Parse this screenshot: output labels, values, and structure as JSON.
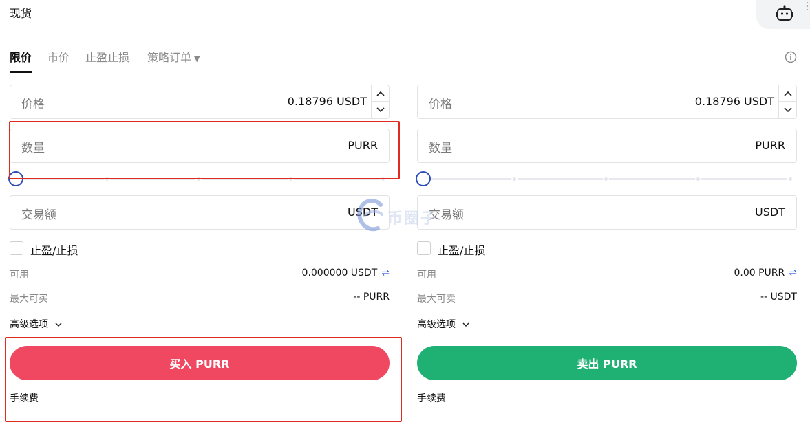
{
  "page": {
    "title": "现货"
  },
  "tabs": [
    {
      "label": "限价",
      "active": true
    },
    {
      "label": "市价",
      "active": false
    },
    {
      "label": "止盈止损",
      "active": false
    },
    {
      "label": "策略订单",
      "active": false,
      "has_dropdown": true
    }
  ],
  "buy": {
    "price_label": "价格",
    "price_value": "0.18796 USDT",
    "qty_label": "数量",
    "qty_unit": "PURR",
    "slider_percent": 0,
    "amount_label": "交易额",
    "amount_unit": "USDT",
    "tpsl_label": "止盈/止损",
    "available_label": "可用",
    "available_value": "0.000000 USDT",
    "max_label": "最大可买",
    "max_value": "-- PURR",
    "advanced_label": "高级选项",
    "button_label": "买入 PURR",
    "fee_label": "手续费"
  },
  "sell": {
    "price_label": "价格",
    "price_value": "0.18796 USDT",
    "qty_label": "数量",
    "qty_unit": "PURR",
    "slider_percent": 0,
    "amount_label": "交易额",
    "amount_unit": "USDT",
    "tpsl_label": "止盈/止损",
    "available_label": "可用",
    "available_value": "0.00 PURR",
    "max_label": "最大可卖",
    "max_value": "-- USDT",
    "advanced_label": "高级选项",
    "button_label": "卖出 PURR",
    "fee_label": "手续费"
  },
  "watermark": {
    "text": "币圈子"
  },
  "colors": {
    "buy": "#f04861",
    "sell": "#1fb073",
    "accent": "#2b4db8",
    "highlight": "#e02b20"
  },
  "icons": {
    "bot": "robot-icon",
    "info": "info-icon",
    "swap": "swap-icon",
    "chevron": "chevron-down-icon"
  }
}
